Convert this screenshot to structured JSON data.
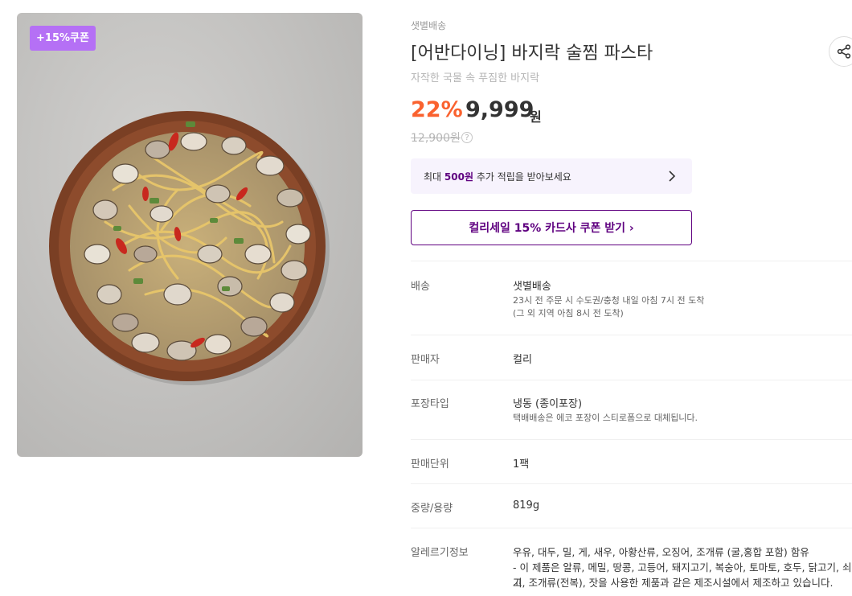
{
  "badge": {
    "coupon": "+15%쿠폰"
  },
  "product": {
    "delivery_tag": "샛별배송",
    "title": "[어반다이닝] 바지락 술찜 파스타",
    "subtitle": "자작한 국물 속 푸짐한 바지락",
    "discount": "22%",
    "price": "9,999",
    "currency": "원",
    "original_price": "12,900원"
  },
  "points_banner": {
    "prefix": "최대 ",
    "amount": "500원",
    "suffix": " 추가 적립을 받아보세요"
  },
  "coupon_button": {
    "label": "컬리세일 15% 카드사 쿠폰 받기 ›"
  },
  "info": {
    "delivery": {
      "label": "배송",
      "value": "샛별배송",
      "sub1": "23시 전 주문 시 수도권/충청 내일 아침 7시 전 도착",
      "sub2": "(그 외 지역 아침 8시 전 도착)"
    },
    "seller": {
      "label": "판매자",
      "value": "컬리"
    },
    "packaging": {
      "label": "포장타입",
      "value": "냉동 (종이포장)",
      "sub": "택배배송은 에코 포장이 스티로폼으로 대체됩니다."
    },
    "unit": {
      "label": "판매단위",
      "value": "1팩"
    },
    "weight": {
      "label": "중량/용량",
      "value": "819g"
    },
    "allergy": {
      "label": "알레르기정보",
      "line1": "우유, 대두, 밀, 게, 새우, 아황산류, 오징어, 조개류 (굴,홍합 포함) 함유",
      "line2": "- 이 제품은 알류, 메밀, 땅콩, 고등어, 돼지고기, 복숭아, 토마토, 호두, 닭고기, 쇠고",
      "line3": "기, 조개류(전복), 잣을 사용한 제품과 같은 제조시설에서 제조하고 있습니다."
    }
  },
  "colors": {
    "accent": "#5f0080",
    "discount": "#fa622f",
    "badge": "#b570f5"
  }
}
